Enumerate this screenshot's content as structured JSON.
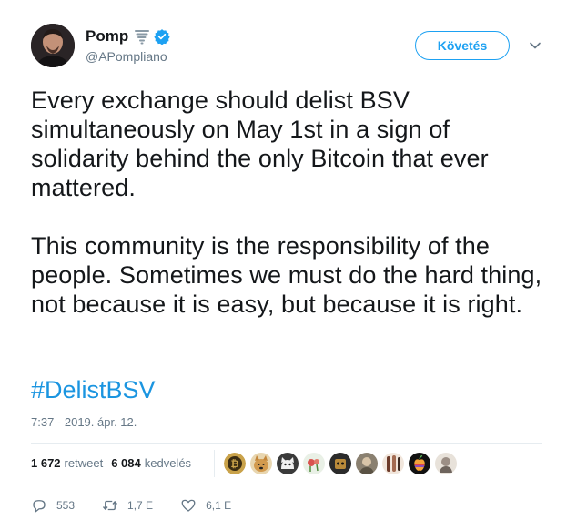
{
  "author": {
    "name": "Pomp",
    "handle": "@APompliano",
    "avatar_icon": "avatar-photo",
    "name_emoji_icon": "tornado-icon",
    "verified_icon": "verified-badge-icon"
  },
  "follow_button_label": "Követés",
  "tweet": {
    "paragraphs": [
      "Every exchange should delist BSV simultaneously on May 1st in a sign of solidarity behind the only Bitcoin that ever mattered.",
      "This community is the responsibility of the people. Sometimes we must do the hard thing, not because it is easy, but because it is right."
    ],
    "hashtag": "#DelistBSV",
    "timestamp": "7:37 - 2019. ápr. 12."
  },
  "stats": {
    "retweets_count": "1 672",
    "retweets_label": "retweet",
    "likes_count": "6 084",
    "likes_label": "kedvelés"
  },
  "likers": [
    {
      "icon": "bitcoin-avatar",
      "color": "#c9a24a"
    },
    {
      "icon": "doge-avatar",
      "color": "#d9b57a"
    },
    {
      "icon": "cat-avatar",
      "color": "#3a3a3a"
    },
    {
      "icon": "rose-avatar",
      "color": "#d8e6d8"
    },
    {
      "icon": "robot-avatar",
      "color": "#2b2b2b"
    },
    {
      "icon": "portrait-avatar",
      "color": "#8a8070"
    },
    {
      "icon": "figure-avatar",
      "color": "#a36b52"
    },
    {
      "icon": "apple-logo-avatar",
      "color": "#111111"
    },
    {
      "icon": "sketch-avatar",
      "color": "#9c8f86"
    }
  ],
  "actions": {
    "reply_count": "553",
    "retweet_count": "1,7 E",
    "like_count": "6,1 E"
  },
  "colors": {
    "accent": "#1da1f2",
    "hashtag": "#1b95e0",
    "secondary_text": "#657786",
    "divider": "#e6ecf0"
  }
}
